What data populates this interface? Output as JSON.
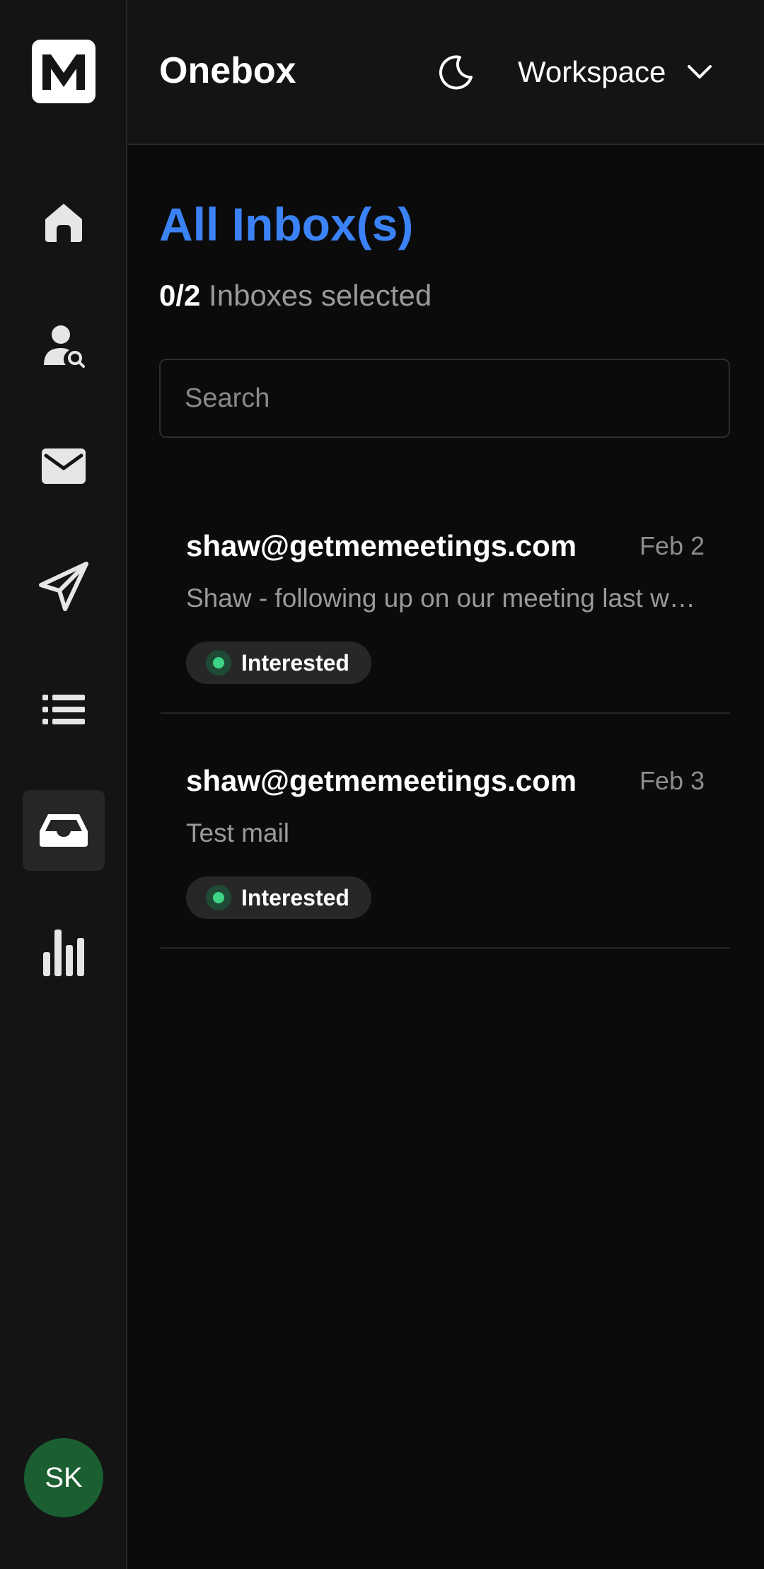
{
  "sidebar": {
    "logo": "M-logo-icon",
    "items": [
      {
        "id": "home",
        "icon": "home-icon"
      },
      {
        "id": "contacts",
        "icon": "user-search-icon"
      },
      {
        "id": "mail",
        "icon": "envelope-icon"
      },
      {
        "id": "send",
        "icon": "paper-plane-icon"
      },
      {
        "id": "list",
        "icon": "list-icon"
      },
      {
        "id": "inbox",
        "icon": "inbox-tray-icon",
        "active": true
      },
      {
        "id": "analytics",
        "icon": "bar-chart-icon"
      }
    ],
    "avatar_initials": "SK"
  },
  "header": {
    "title": "Onebox",
    "theme_icon": "moon-icon",
    "workspace_label": "Workspace"
  },
  "main": {
    "title": "All Inbox(s)",
    "selection": {
      "count": "0/2",
      "label": " Inboxes selected"
    },
    "search": {
      "placeholder": "Search",
      "value": ""
    },
    "messages": [
      {
        "from": "shaw@getmemeetings.com",
        "date": "Feb 2",
        "preview": "Shaw - following up on our meeting last week...",
        "tag": "Interested"
      },
      {
        "from": "shaw@getmemeetings.com",
        "date": "Feb 3",
        "preview": "Test mail",
        "tag": "Interested"
      }
    ]
  },
  "colors": {
    "accent": "#3b82f6",
    "sidebar_bg": "#141414",
    "page_bg": "#0b0b0b",
    "tag_dot": "#3ed486",
    "avatar_bg": "#1a5e32"
  }
}
